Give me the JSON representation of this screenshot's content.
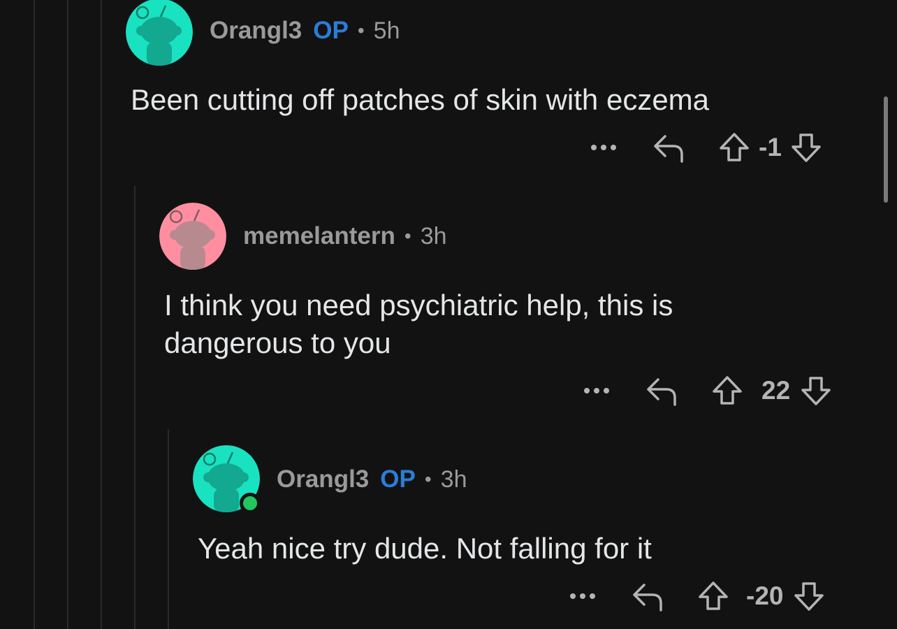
{
  "comments": [
    {
      "username": "Orangl3",
      "op_badge": "OP",
      "separator": "•",
      "time": "5h",
      "text": "Been cutting off patches of skin with eczema",
      "more_label": "•••",
      "score": "-1",
      "avatar_color": "#19e2c1"
    },
    {
      "username": "memelantern",
      "separator": "•",
      "time": "3h",
      "text": "I think you need psychiatric help, this is dangerous to you",
      "more_label": "•••",
      "score": "22",
      "avatar_color": "#ff8fa0"
    },
    {
      "username": "Orangl3",
      "op_badge": "OP",
      "separator": "•",
      "time": "3h",
      "text": "Yeah nice try dude. Not falling for it",
      "more_label": "•••",
      "score": "-20",
      "avatar_color": "#19e2c1",
      "online": true
    }
  ],
  "icons": {
    "more": "more-options-icon",
    "reply": "reply-icon",
    "upvote": "upvote-arrow-icon",
    "downvote": "downvote-arrow-icon",
    "avatar": "snoo-avatar-icon"
  }
}
